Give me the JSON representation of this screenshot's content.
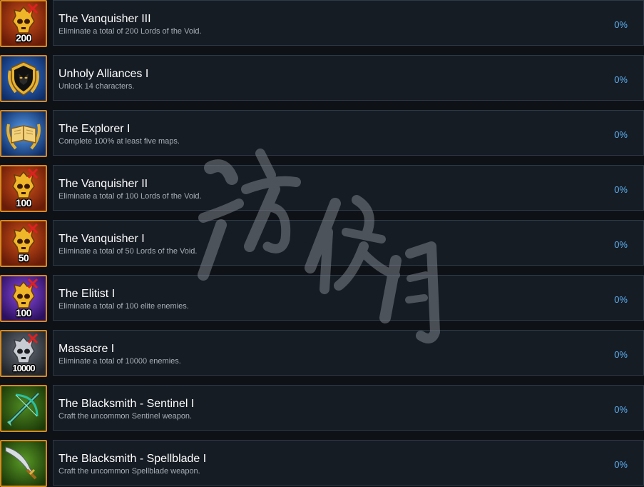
{
  "achievements": [
    {
      "title": "The Vanquisher III",
      "description": "Eliminate a total of 200 Lords of the Void.",
      "percent": "0%",
      "badge": "200",
      "icon": "skull-crossed-swords-icon",
      "icon_bg": "#8a2a0c"
    },
    {
      "title": "Unholy Alliances I",
      "description": "Unlock 14 characters.",
      "percent": "0%",
      "badge": "",
      "icon": "shield-laurel-icon",
      "icon_bg": "#1a4fa0"
    },
    {
      "title": "The Explorer I",
      "description": "Complete 100% at least five maps.",
      "percent": "0%",
      "badge": "",
      "icon": "map-book-laurel-icon",
      "icon_bg": "#1a4fa0"
    },
    {
      "title": "The Vanquisher II",
      "description": "Eliminate a total of 100 Lords of the Void.",
      "percent": "0%",
      "badge": "100",
      "icon": "skull-crossed-swords-icon",
      "icon_bg": "#8a2a0c"
    },
    {
      "title": "The Vanquisher I",
      "description": "Eliminate a total of 50 Lords of the Void.",
      "percent": "0%",
      "badge": "50",
      "icon": "skull-crossed-swords-icon",
      "icon_bg": "#8a2a0c"
    },
    {
      "title": "The Elitist I",
      "description": "Eliminate a total of 100 elite enemies.",
      "percent": "0%",
      "badge": "100",
      "icon": "skull-crossed-swords-icon",
      "icon_bg": "#4a2290"
    },
    {
      "title": "Massacre I",
      "description": "Eliminate a total of 10000 enemies.",
      "percent": "0%",
      "badge": "10000",
      "icon": "skull-crossed-swords-icon",
      "icon_bg": "#3a3f48"
    },
    {
      "title": "The Blacksmith - Sentinel I",
      "description": "Craft the uncommon Sentinel weapon.",
      "percent": "0%",
      "badge": "",
      "icon": "crossbow-icon",
      "icon_bg": "#3c6a14"
    },
    {
      "title": "The Blacksmith - Spellblade I",
      "description": "Craft the uncommon Spellblade weapon.",
      "percent": "0%",
      "badge": "",
      "icon": "curved-sword-icon",
      "icon_bg": "#3c6a14"
    }
  ],
  "colors": {
    "page_bg": "#0e1116",
    "panel_bg": "#161c24",
    "panel_border": "#2d3a47",
    "icon_border": "#d98a1e",
    "title": "#ffffff",
    "description": "#a8b0b8",
    "percent": "#5cb1f5"
  },
  "watermark": {
    "kind": "site-watermark-calligraphy",
    "color": "#7a8088"
  }
}
